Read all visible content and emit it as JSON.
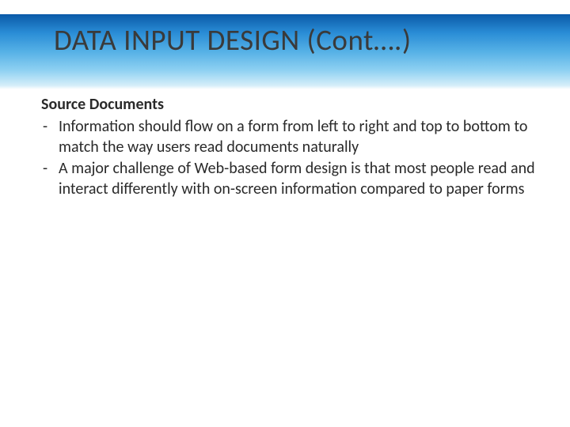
{
  "slide": {
    "title": "DATA INPUT DESIGN (Cont….)",
    "subheading": "Source Documents",
    "bullets": [
      "Information should flow on a form from left to right and top to bottom to match the way users read documents naturally",
      "A major challenge of Web-based form design is that most people read and interact differently with on-screen information compared to paper forms"
    ]
  }
}
